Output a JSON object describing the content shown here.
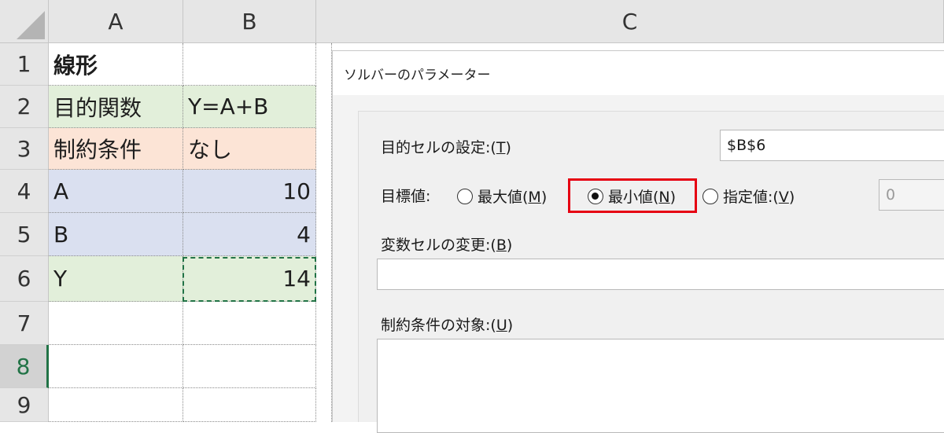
{
  "columns": [
    "A",
    "B",
    "C"
  ],
  "rows": [
    "1",
    "2",
    "3",
    "4",
    "5",
    "6",
    "7",
    "8",
    "9"
  ],
  "cells": {
    "a1": "線形",
    "a2": "目的関数",
    "b2": "Y=A+B",
    "a3": "制約条件",
    "b3": "なし",
    "a4": "A",
    "b4": "10",
    "a5": "B",
    "b5": "4",
    "a6": "Y",
    "b6": "14"
  },
  "dialog": {
    "title": "ソルバーのパラメーター",
    "objective_label": "目的セルの設定:(",
    "objective_key": "T",
    "objective_value": "$B$6",
    "target_label": "目標値:",
    "options": [
      {
        "label": "最大値(",
        "key": "M",
        "suffix": ")",
        "checked": false
      },
      {
        "label": "最小値(",
        "key": "N",
        "suffix": ")",
        "checked": true
      },
      {
        "label": "指定値:(",
        "key": "V",
        "suffix": ")",
        "checked": false
      }
    ],
    "specified_value": "0",
    "variables_label": "変数セルの変更:(",
    "variables_key": "B",
    "variables_value": "",
    "constraints_label": "制約条件の対象:(",
    "constraints_key": "U"
  },
  "colors": {
    "highlight": "#e60012",
    "selection": "#217346"
  }
}
